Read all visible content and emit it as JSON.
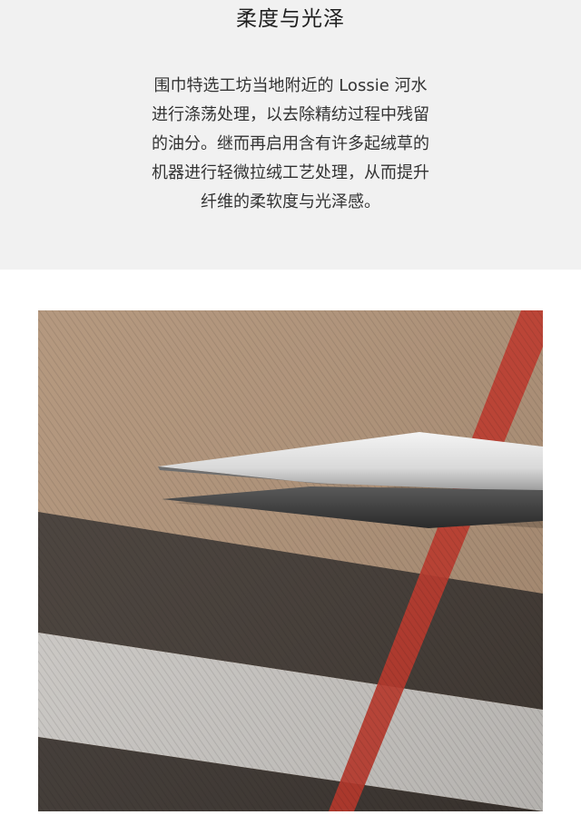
{
  "section": {
    "title": "柔度与光泽",
    "description_lines": [
      "围巾特选工坊当地附近的 Lossie 河水",
      "进行涤荡处理，以去除精纺过程中残留",
      "的油分。继而再启用含有许多起绒草的",
      "机器进行轻微拉绒工艺处理，从而提升",
      "纤维的柔软度与光泽感。"
    ]
  },
  "image": {
    "subject": "scissors-cutting-check-scarf",
    "colors": {
      "camel": "#b09277",
      "dark_stripe": "#433b35",
      "light_stripe": "#cdcac6",
      "red_stripe": "#c2382a",
      "panel_bg": "#f1f1f1"
    }
  }
}
